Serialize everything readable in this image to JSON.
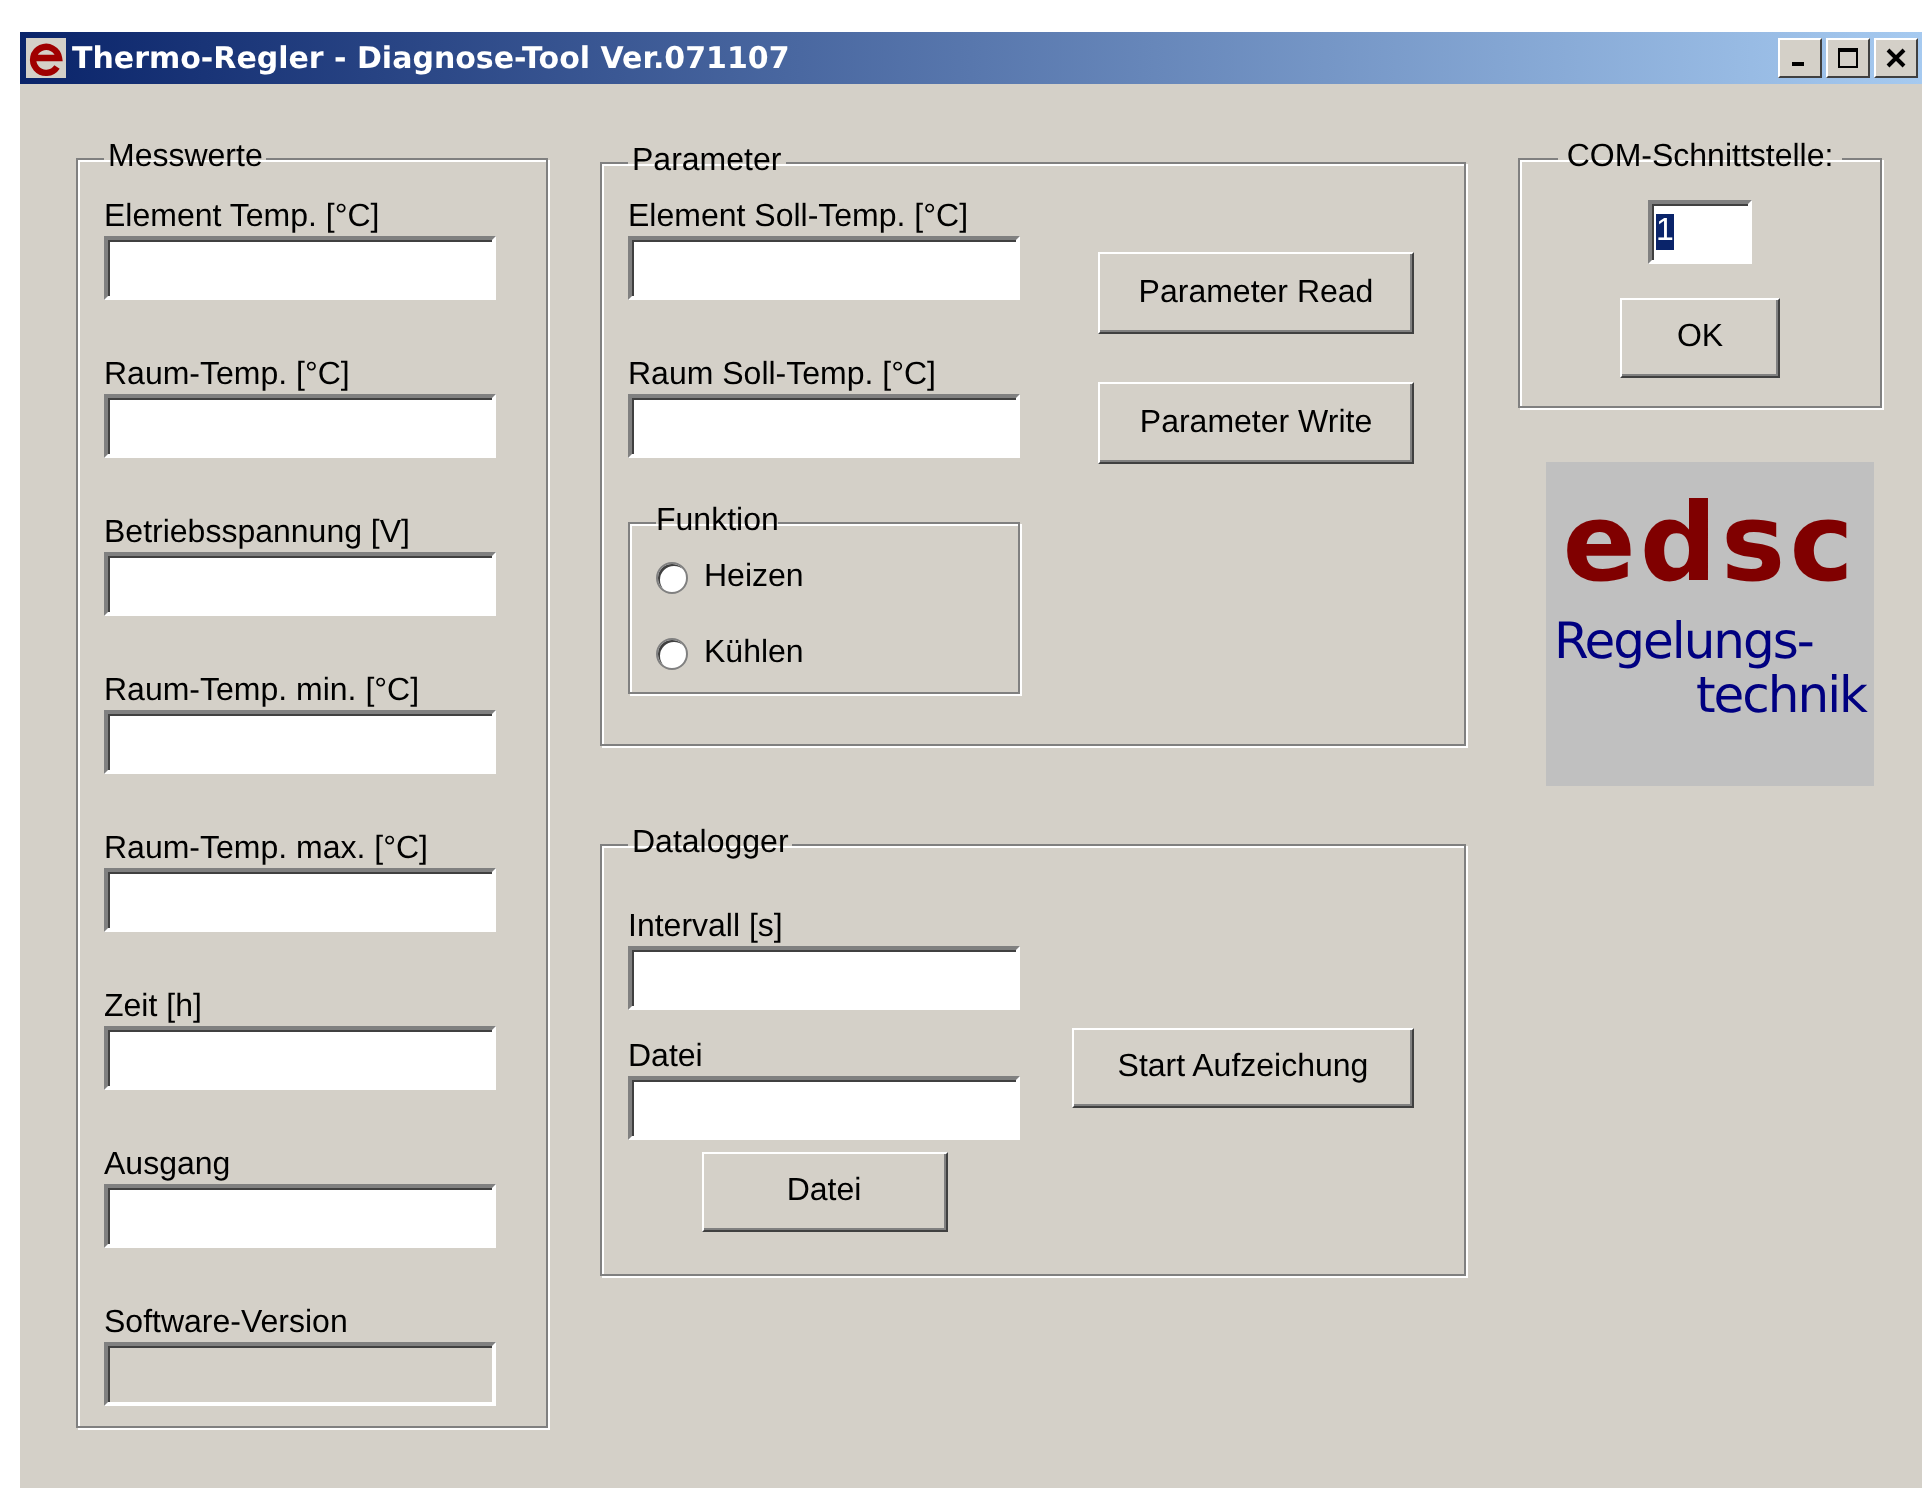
{
  "window": {
    "title": "Thermo-Regler - Diagnose-Tool Ver.071107"
  },
  "measurements": {
    "title": "Messwerte",
    "fields": [
      {
        "label": "Element Temp. [°C]",
        "disabled": false
      },
      {
        "label": "Raum-Temp. [°C]",
        "disabled": false
      },
      {
        "label": "Betriebsspannung [V]",
        "disabled": false
      },
      {
        "label": "Raum-Temp. min. [°C]",
        "disabled": false
      },
      {
        "label": "Raum-Temp. max. [°C]",
        "disabled": false
      },
      {
        "label": "Zeit [h]",
        "disabled": false
      },
      {
        "label": "Ausgang",
        "disabled": false
      },
      {
        "label": "Software-Version",
        "disabled": true
      }
    ]
  },
  "parameter": {
    "title": "Parameter",
    "fields": [
      {
        "label": "Element Soll-Temp. [°C]",
        "disabled": false
      },
      {
        "label": "Raum Soll-Temp. [°C]",
        "disabled": false
      }
    ],
    "buttons": [
      "Parameter Read",
      "Parameter Write"
    ],
    "function": {
      "title": "Funktion",
      "options": [
        {
          "label": "Heizen",
          "selected": false
        },
        {
          "label": "Kühlen",
          "selected": false
        }
      ]
    }
  },
  "datalogger": {
    "title": "Datalogger",
    "fields": [
      {
        "label": "Intervall [s]",
        "disabled": false
      },
      {
        "label": "Datei",
        "disabled": false
      }
    ],
    "start_button": "Start Aufzeichung",
    "file_button": "Datei"
  },
  "com_port": {
    "title": "COM-Schnittstelle:",
    "value": "1",
    "button": "OK"
  },
  "logo": {
    "name": "edsc",
    "line_1": "Regelungs-",
    "line_2": "technik"
  }
}
